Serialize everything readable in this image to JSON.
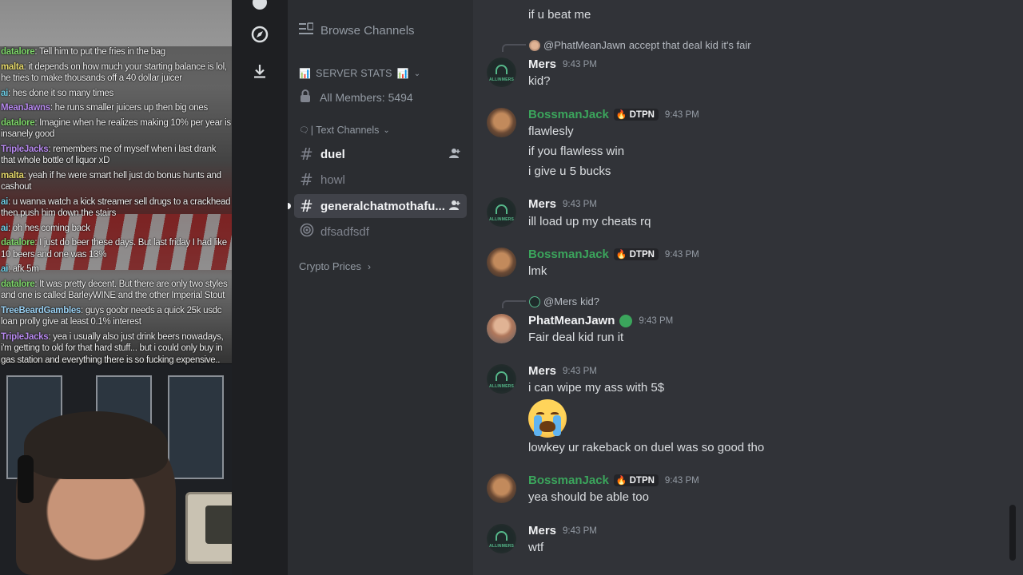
{
  "stream_chat": [
    {
      "user": "datalore",
      "color": "#7fd86b",
      "text": "Tell him to put the fries in the bag"
    },
    {
      "user": "malta",
      "color": "#e6d96a",
      "text": "it depends on how much your starting balance is lol, he tries to make thousands off a 40 dollar juicer"
    },
    {
      "user": "ai",
      "color": "#6fd0e8",
      "text": "hes done it so many times"
    },
    {
      "user": "MeanJawns",
      "color": "#b98bf0",
      "text": "he runs smaller juicers up then big ones"
    },
    {
      "user": "datalore",
      "color": "#7fd86b",
      "text": "Imagine when he realizes making 10% per year is insanely good"
    },
    {
      "user": "TripleJacks",
      "color": "#b98bf0",
      "text": "remembers me of myself when i last drank that whole bottle of liquor xD"
    },
    {
      "user": "malta",
      "color": "#e6d96a",
      "text": "yeah if he were smart hell just do bonus hunts and cashout"
    },
    {
      "user": "ai",
      "color": "#6fd0e8",
      "text": "u wanna watch a kick streamer sell drugs to a crackhead then push him down the stairs"
    },
    {
      "user": "ai",
      "color": "#6fd0e8",
      "text": "oh hes coming back"
    },
    {
      "user": "datalore",
      "color": "#7fd86b",
      "text": "I just do beer these days. But last friday I had like 10 beers and one was 13%"
    },
    {
      "user": "ai",
      "color": "#6fd0e8",
      "text": "afk 5m"
    },
    {
      "user": "datalore",
      "color": "#7fd86b",
      "text": "It was pretty decent. But there are only two styles and one is called BarleyWINE and the other Imperial Stout"
    },
    {
      "user": "TreeBeardGambles",
      "color": "#9ad0f2",
      "text": "guys goobr needs a quick 25k usdc loan prolly give at least 0.1% interest"
    },
    {
      "user": "TripleJacks",
      "color": "#b98bf0",
      "text": "yea i usually also just drink beers nowadays, i'm getting to old for that hard stuff... but i could only buy in gas station and everything there is so fucking expensive.."
    }
  ],
  "sidebar": {
    "browse_channels": "Browse Channels",
    "server_stats_category": "SERVER STATS",
    "stats_emoji": "📊",
    "all_members": "All Members: 5494",
    "text_channels_category": "| Text Channels",
    "channels": [
      {
        "name": "duel",
        "state": "unread"
      },
      {
        "name": "howl",
        "state": "muted"
      },
      {
        "name": "generalchatmothafu...",
        "state": "active"
      },
      {
        "name": "dfsadfsdf",
        "state": "muted"
      }
    ],
    "crypto_prices": "Crypto Prices"
  },
  "messages": {
    "top_line": "if u beat me",
    "reply1": {
      "mention": "@PhatMeanJawn",
      "text": "accept that deal kid it's fair"
    },
    "m1": {
      "author": "Mers",
      "time": "9:43 PM",
      "lines": [
        "kid?"
      ]
    },
    "m2": {
      "author": "BossmanJack",
      "tag": "DTPN",
      "time": "9:43 PM",
      "lines": [
        "flawlesly",
        "if you flawless win",
        "i give u 5 bucks"
      ]
    },
    "m3": {
      "author": "Mers",
      "time": "9:43 PM",
      "lines": [
        "ill load up my cheats rq"
      ]
    },
    "m4": {
      "author": "BossmanJack",
      "tag": "DTPN",
      "time": "9:43 PM",
      "lines": [
        "lmk"
      ]
    },
    "reply2": {
      "mention": "@Mers",
      "text": "kid?"
    },
    "m5": {
      "author": "PhatMeanJawn",
      "time": "9:43 PM",
      "lines": [
        "Fair deal kid run it"
      ]
    },
    "m6": {
      "author": "Mers",
      "time": "9:43 PM",
      "lines": [
        "i can wipe my ass with 5$",
        "lowkey ur rakeback on duel was so good tho"
      ]
    },
    "m7": {
      "author": "BossmanJack",
      "tag": "DTPN",
      "time": "9:43 PM",
      "lines": [
        "yea should be able too"
      ]
    },
    "m8": {
      "author": "Mers",
      "time": "9:43 PM",
      "lines": [
        "wtf"
      ]
    },
    "mers_logo_text": "ALLINMERS"
  },
  "colors": {
    "bossman": "#3ba55c",
    "mers": "#f2f3f5",
    "phat": "#f2f3f5"
  }
}
